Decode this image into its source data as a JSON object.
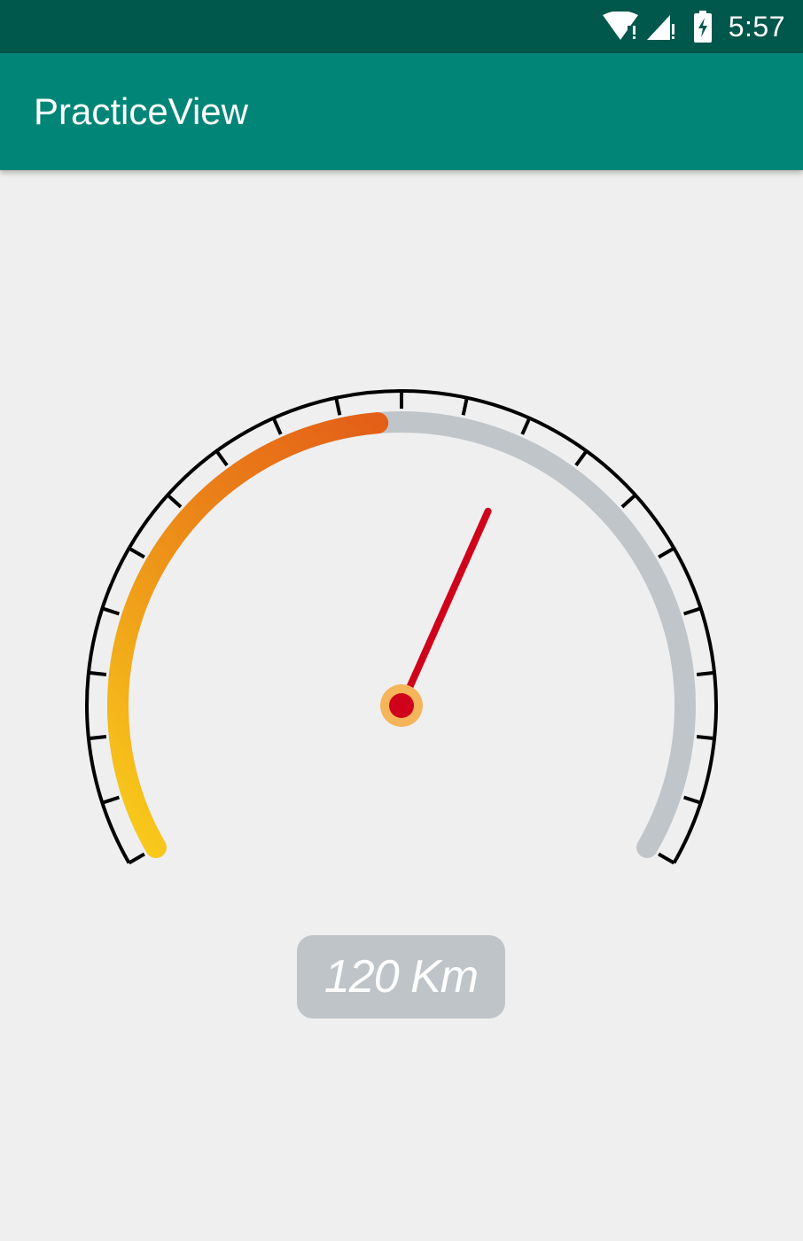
{
  "status_bar": {
    "time": "5:57",
    "icons": [
      "wifi-alert-icon",
      "cell-signal-alert-icon",
      "battery-charging-icon"
    ]
  },
  "app_bar": {
    "title": "PracticeView"
  },
  "speedometer": {
    "progress_fraction": 0.48,
    "major_tick_count": 21,
    "colors": {
      "progress_start": "#f8cc1b",
      "progress_mid": "#ea7f18",
      "progress_end": "#e04e17",
      "track": "#c0c5c9",
      "scale": "#000000",
      "needle": "#d0021b",
      "hub_outer": "#f6b55a",
      "hub_inner": "#d0021b"
    },
    "readout": "120 Km"
  }
}
